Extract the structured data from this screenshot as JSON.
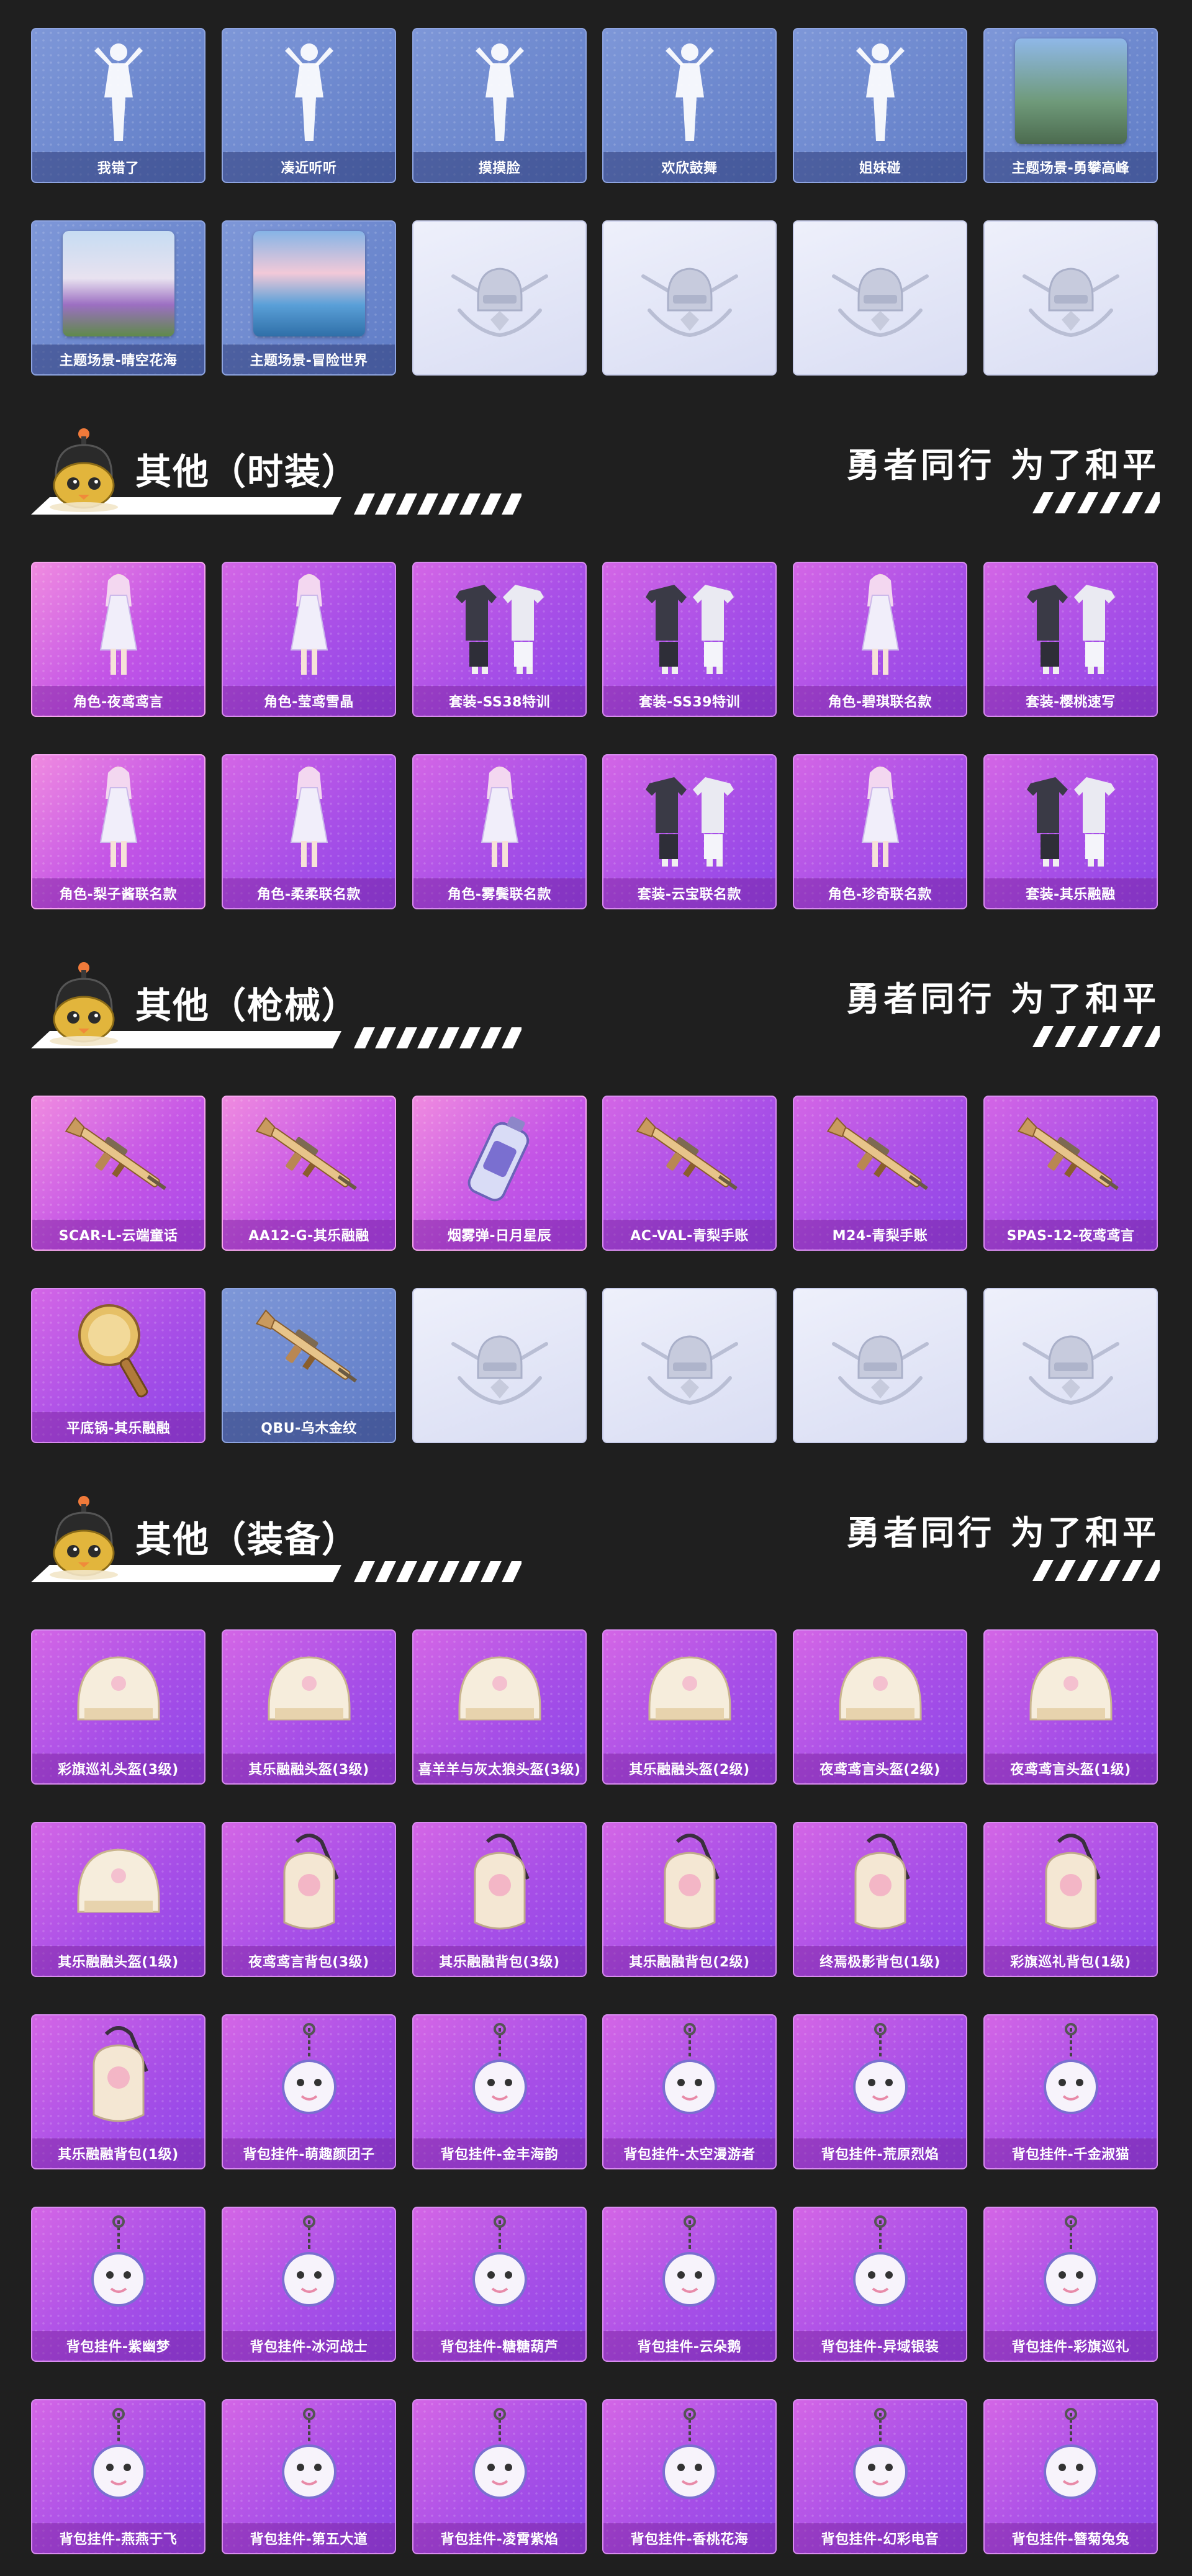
{
  "row_emotes": {
    "items": [
      {
        "label": "我错了",
        "icon": "emote-pose-icon",
        "style": "blue"
      },
      {
        "label": "凑近听听",
        "icon": "emote-pose-icon",
        "style": "blue"
      },
      {
        "label": "摸摸脸",
        "icon": "emote-pose-icon",
        "style": "blue"
      },
      {
        "label": "欢欣鼓舞",
        "icon": "emote-pose-icon",
        "style": "blue"
      },
      {
        "label": "姐妹碰",
        "icon": "emote-pose-icon",
        "style": "blue"
      },
      {
        "label": "主题场景-勇攀高峰",
        "icon": "scene-thumb-icon",
        "style": "blue",
        "thumb": "mountain"
      }
    ]
  },
  "row_scenes": {
    "items": [
      {
        "label": "主题场景-晴空花海",
        "icon": "scene-thumb-icon",
        "style": "blue",
        "thumb": "flowers"
      },
      {
        "label": "主题场景-冒险世界",
        "icon": "scene-thumb-icon",
        "style": "blue",
        "thumb": "ocean"
      },
      {
        "label": "",
        "icon": "placeholder-emblem-icon",
        "style": "empty"
      },
      {
        "label": "",
        "icon": "placeholder-emblem-icon",
        "style": "empty"
      },
      {
        "label": "",
        "icon": "placeholder-emblem-icon",
        "style": "empty"
      },
      {
        "label": "",
        "icon": "placeholder-emblem-icon",
        "style": "empty"
      }
    ]
  },
  "section_fashion": {
    "title": "其他（时装）",
    "slogan": "勇者同行 为了和平"
  },
  "row_fashion1": {
    "items": [
      {
        "label": "角色-夜鸢鸢言",
        "icon": "character-outfit-icon",
        "style": "pink"
      },
      {
        "label": "角色-莹鸢雪晶",
        "icon": "character-outfit-icon",
        "style": "purple"
      },
      {
        "label": "套装-SS38特训",
        "icon": "outfit-set-icon",
        "style": "purple"
      },
      {
        "label": "套装-SS39特训",
        "icon": "outfit-set-icon",
        "style": "purple"
      },
      {
        "label": "角色-碧琪联名款",
        "icon": "character-outfit-icon",
        "style": "purple"
      },
      {
        "label": "套装-樱桃速写",
        "icon": "outfit-set-icon",
        "style": "purple"
      }
    ]
  },
  "row_fashion2": {
    "items": [
      {
        "label": "角色-梨子酱联名款",
        "icon": "character-outfit-icon",
        "style": "pink"
      },
      {
        "label": "角色-柔柔联名款",
        "icon": "character-outfit-icon",
        "style": "purple"
      },
      {
        "label": "角色-雾鬓联名款",
        "icon": "character-outfit-icon",
        "style": "purple"
      },
      {
        "label": "套装-云宝联名款",
        "icon": "outfit-set-icon",
        "style": "purple"
      },
      {
        "label": "角色-珍奇联名款",
        "icon": "character-outfit-icon",
        "style": "purple"
      },
      {
        "label": "套装-其乐融融",
        "icon": "outfit-set-icon",
        "style": "purple"
      }
    ]
  },
  "section_weapons": {
    "title": "其他（枪械）",
    "slogan": "勇者同行 为了和平"
  },
  "row_weapons1": {
    "items": [
      {
        "label": "SCAR-L-云端童话",
        "icon": "rifle-skin-icon",
        "style": "pink"
      },
      {
        "label": "AA12-G-其乐融融",
        "icon": "shotgun-skin-icon",
        "style": "pink"
      },
      {
        "label": "烟雾弹-日月星辰",
        "icon": "grenade-skin-icon",
        "style": "pink"
      },
      {
        "label": "AC-VAL-青梨手账",
        "icon": "rifle-skin-icon",
        "style": "purple"
      },
      {
        "label": "M24-青梨手账",
        "icon": "sniper-skin-icon",
        "style": "purple"
      },
      {
        "label": "SPAS-12-夜鸢鸢言",
        "icon": "shotgun-skin-icon",
        "style": "purple"
      }
    ]
  },
  "row_weapons2": {
    "items": [
      {
        "label": "平底锅-其乐融融",
        "icon": "pan-skin-icon",
        "style": "purple"
      },
      {
        "label": "QBU-乌木金纹",
        "icon": "rifle-skin-icon",
        "style": "blue"
      },
      {
        "label": "",
        "icon": "placeholder-emblem-icon",
        "style": "empty"
      },
      {
        "label": "",
        "icon": "placeholder-emblem-icon",
        "style": "empty"
      },
      {
        "label": "",
        "icon": "placeholder-emblem-icon",
        "style": "empty"
      },
      {
        "label": "",
        "icon": "placeholder-emblem-icon",
        "style": "empty"
      }
    ]
  },
  "section_gear": {
    "title": "其他（装备）",
    "slogan": "勇者同行 为了和平"
  },
  "row_gear1": {
    "items": [
      {
        "label": "彩旗巡礼头盔(3级)",
        "icon": "helmet-icon",
        "style": "purple"
      },
      {
        "label": "其乐融融头盔(3级)",
        "icon": "helmet-icon",
        "style": "purple"
      },
      {
        "label": "喜羊羊与灰太狼头盔(3级)",
        "icon": "helmet-icon",
        "style": "purple"
      },
      {
        "label": "其乐融融头盔(2级)",
        "icon": "helmet-icon",
        "style": "purple"
      },
      {
        "label": "夜鸢鸢言头盔(2级)",
        "icon": "helmet-icon",
        "style": "purple"
      },
      {
        "label": "夜鸢鸢言头盔(1级)",
        "icon": "helmet-icon",
        "style": "purple"
      }
    ]
  },
  "row_gear2": {
    "items": [
      {
        "label": "其乐融融头盔(1级)",
        "icon": "helmet-icon",
        "style": "purple"
      },
      {
        "label": "夜鸢鸢言背包(3级)",
        "icon": "backpack-icon",
        "style": "purple"
      },
      {
        "label": "其乐融融背包(3级)",
        "icon": "backpack-icon",
        "style": "purple"
      },
      {
        "label": "其乐融融背包(2级)",
        "icon": "backpack-icon",
        "style": "purple"
      },
      {
        "label": "终焉极影背包(1级)",
        "icon": "backpack-icon",
        "style": "purple"
      },
      {
        "label": "彩旗巡礼背包(1级)",
        "icon": "backpack-icon",
        "style": "purple"
      }
    ]
  },
  "row_gear3": {
    "items": [
      {
        "label": "其乐融融背包(1级)",
        "icon": "backpack-icon",
        "style": "purple"
      },
      {
        "label": "背包挂件-萌趣颜团子",
        "icon": "bag-charm-icon",
        "style": "purple"
      },
      {
        "label": "背包挂件-金丰海韵",
        "icon": "bag-charm-icon",
        "style": "purple"
      },
      {
        "label": "背包挂件-太空漫游者",
        "icon": "bag-charm-icon",
        "style": "purple"
      },
      {
        "label": "背包挂件-荒原烈焰",
        "icon": "bag-charm-icon",
        "style": "purple"
      },
      {
        "label": "背包挂件-千金淑猫",
        "icon": "bag-charm-icon",
        "style": "purple"
      }
    ]
  },
  "row_gear4": {
    "items": [
      {
        "label": "背包挂件-紫幽梦",
        "icon": "bag-charm-icon",
        "style": "purple"
      },
      {
        "label": "背包挂件-冰河战士",
        "icon": "bag-charm-icon",
        "style": "purple"
      },
      {
        "label": "背包挂件-糖糖葫芦",
        "icon": "bag-charm-icon",
        "style": "purple"
      },
      {
        "label": "背包挂件-云朵鹅",
        "icon": "bag-charm-icon",
        "style": "purple"
      },
      {
        "label": "背包挂件-异域银装",
        "icon": "bag-charm-icon",
        "style": "purple"
      },
      {
        "label": "背包挂件-彩旗巡礼",
        "icon": "bag-charm-icon",
        "style": "purple"
      }
    ]
  },
  "row_gear5": {
    "items": [
      {
        "label": "背包挂件-燕燕于飞",
        "icon": "bag-charm-icon",
        "style": "purple"
      },
      {
        "label": "背包挂件-第五大道",
        "icon": "bag-charm-icon",
        "style": "purple"
      },
      {
        "label": "背包挂件-凌霄紫焰",
        "icon": "bag-charm-icon",
        "style": "purple"
      },
      {
        "label": "背包挂件-香桃花海",
        "icon": "bag-charm-icon",
        "style": "purple"
      },
      {
        "label": "背包挂件-幻彩电音",
        "icon": "bag-charm-icon",
        "style": "purple"
      },
      {
        "label": "背包挂件-簪菊兔兔",
        "icon": "bag-charm-icon",
        "style": "purple"
      }
    ]
  },
  "colors": {
    "background": "#1f1f1f",
    "blue_card": "#6b86cf",
    "pink_card": "#e37ee3",
    "purple_card": "#a84fe7",
    "empty_card": "#e3e6f6",
    "text": "#ffffff"
  }
}
